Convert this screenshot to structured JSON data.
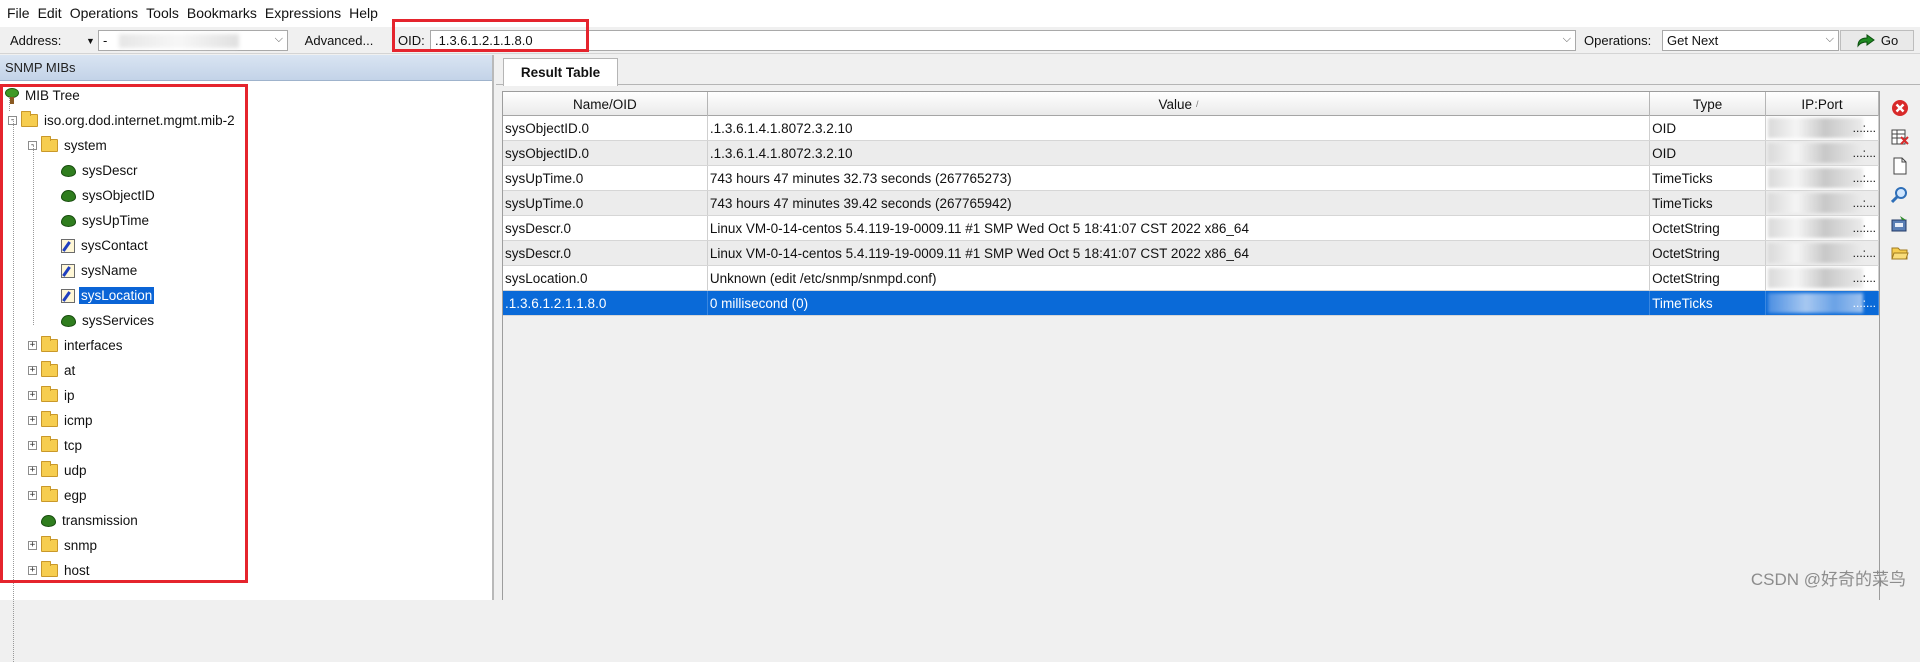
{
  "menu": [
    "File",
    "Edit",
    "Operations",
    "Tools",
    "Bookmarks",
    "Expressions",
    "Help"
  ],
  "toolbar": {
    "address_label": "Address:",
    "address_value": "-",
    "advanced_label": "Advanced...",
    "oid_label": "OID:",
    "oid_value": ".1.3.6.1.2.1.1.8.0",
    "operations_label": "Operations:",
    "operation_value": "Get Next",
    "go_label": "Go"
  },
  "left_panel": {
    "header": "SNMP MIBs",
    "tree": [
      {
        "label": "MIB Tree",
        "icon": "tree-icon",
        "level": 0,
        "expander": ""
      },
      {
        "label": "iso.org.dod.internet.mgmt.mib-2",
        "icon": "folder-icon",
        "level": 1,
        "expander": "-"
      },
      {
        "label": "system",
        "icon": "folder-icon",
        "level": 2,
        "expander": "-"
      },
      {
        "label": "sysDescr",
        "icon": "leaf-icon",
        "level": 3,
        "expander": ""
      },
      {
        "label": "sysObjectID",
        "icon": "leaf-icon",
        "level": 3,
        "expander": ""
      },
      {
        "label": "sysUpTime",
        "icon": "leaf-icon",
        "level": 3,
        "expander": ""
      },
      {
        "label": "sysContact",
        "icon": "edit-icon",
        "level": 3,
        "expander": ""
      },
      {
        "label": "sysName",
        "icon": "edit-icon",
        "level": 3,
        "expander": ""
      },
      {
        "label": "sysLocation",
        "icon": "edit-icon",
        "level": 3,
        "expander": "",
        "selected": true
      },
      {
        "label": "sysServices",
        "icon": "leaf-icon",
        "level": 3,
        "expander": ""
      },
      {
        "label": "interfaces",
        "icon": "folder-icon",
        "level": 2,
        "expander": "+"
      },
      {
        "label": "at",
        "icon": "folder-icon",
        "level": 2,
        "expander": "+"
      },
      {
        "label": "ip",
        "icon": "folder-icon",
        "level": 2,
        "expander": "+"
      },
      {
        "label": "icmp",
        "icon": "folder-icon",
        "level": 2,
        "expander": "+"
      },
      {
        "label": "tcp",
        "icon": "folder-icon",
        "level": 2,
        "expander": "+"
      },
      {
        "label": "udp",
        "icon": "folder-icon",
        "level": 2,
        "expander": "+"
      },
      {
        "label": "egp",
        "icon": "folder-icon",
        "level": 2,
        "expander": "+"
      },
      {
        "label": "transmission",
        "icon": "leaf-icon",
        "level": 2,
        "expander": ""
      },
      {
        "label": "snmp",
        "icon": "folder-icon",
        "level": 2,
        "expander": "+"
      },
      {
        "label": "host",
        "icon": "folder-icon",
        "level": 2,
        "expander": "+"
      }
    ]
  },
  "result": {
    "tab_label": "Result Table",
    "columns": [
      "Name/OID",
      "Value",
      "Type",
      "IP:Port"
    ],
    "sort_indicator": "/",
    "rows": [
      {
        "name": "sysObjectID.0",
        "value": ".1.3.6.1.4.1.8072.3.2.10",
        "type": "OID",
        "ip": "...:..."
      },
      {
        "name": "sysObjectID.0",
        "value": ".1.3.6.1.4.1.8072.3.2.10",
        "type": "OID",
        "ip": "...:..."
      },
      {
        "name": "sysUpTime.0",
        "value": "743 hours 47 minutes 32.73 seconds (267765273)",
        "type": "TimeTicks",
        "ip": "...:..."
      },
      {
        "name": "sysUpTime.0",
        "value": "743 hours 47 minutes 39.42 seconds (267765942)",
        "type": "TimeTicks",
        "ip": "...:..."
      },
      {
        "name": "sysDescr.0",
        "value": "Linux VM-0-14-centos 5.4.119-19-0009.11 #1 SMP Wed Oct 5 18:41:07 CST 2022 x86_64",
        "type": "OctetString",
        "ip": "...:..."
      },
      {
        "name": "sysDescr.0",
        "value": "Linux VM-0-14-centos 5.4.119-19-0009.11 #1 SMP Wed Oct 5 18:41:07 CST 2022 x86_64",
        "type": "OctetString",
        "ip": "...:..."
      },
      {
        "name": "sysLocation.0",
        "value": "Unknown (edit /etc/snmp/snmpd.conf)",
        "type": "OctetString",
        "ip": "...:..."
      },
      {
        "name": ".1.3.6.1.2.1.1.8.0",
        "value": "0 millisecond (0)",
        "type": "TimeTicks",
        "ip": "...:...",
        "selected": true
      }
    ]
  },
  "side_tools": [
    "delete-icon",
    "clear-table-icon",
    "document-icon",
    "find-icon",
    "save-icon",
    "open-folder-icon"
  ],
  "watermark": "CSDN @好奇的菜鸟",
  "colors": {
    "selection": "#0a6ad8",
    "highlight_border": "#e5242d",
    "panel_header": "#c3d3e8"
  }
}
